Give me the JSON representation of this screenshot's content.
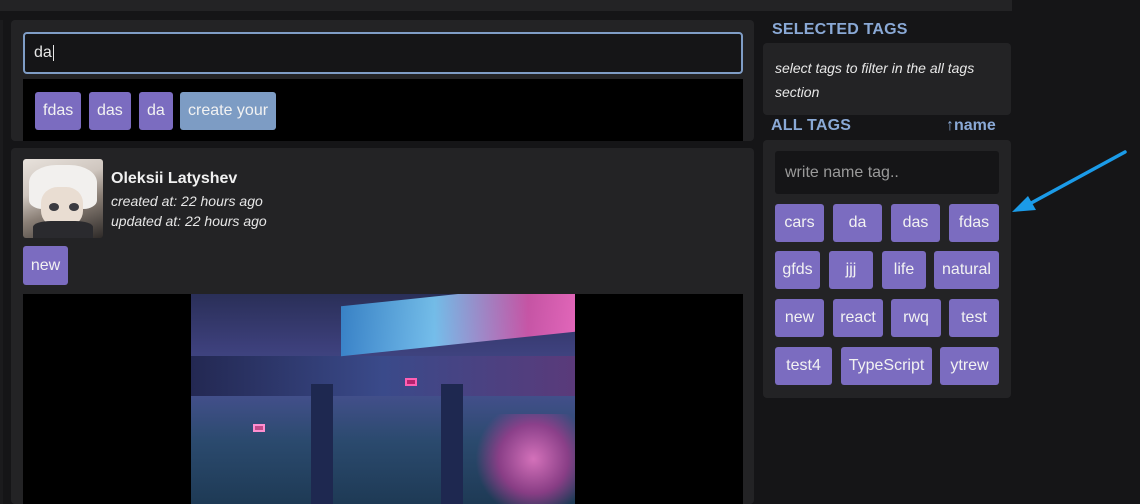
{
  "search": {
    "value": "da",
    "suggestions": [
      "fdas",
      "das",
      "da"
    ],
    "create_label": "create your"
  },
  "post": {
    "author": "Oleksii Latyshev",
    "created": "created at: 22 hours ago",
    "updated": "updated at: 22 hours ago",
    "tags": [
      "new"
    ]
  },
  "sidebar": {
    "selected_title": "SELECTED TAGS",
    "selected_hint": "select tags to filter in the all tags section",
    "all_title": "ALL TAGS",
    "sort_label": "↑name",
    "tag_input_placeholder": "write name tag..",
    "tags": [
      "cars",
      "da",
      "das",
      "fdas",
      "gfds",
      "jjj",
      "life",
      "natural",
      "new",
      "react",
      "rwq",
      "test",
      "test4",
      "TypeScript",
      "ytrew"
    ]
  },
  "colors": {
    "background": "#151517",
    "panel": "#232325",
    "tag": "#7b6cc0",
    "create_chip": "#7d9cc4",
    "accent": "#8aa9d6",
    "arrow": "#1b9be8"
  },
  "icons": {
    "annotation": "arrow-icon"
  }
}
